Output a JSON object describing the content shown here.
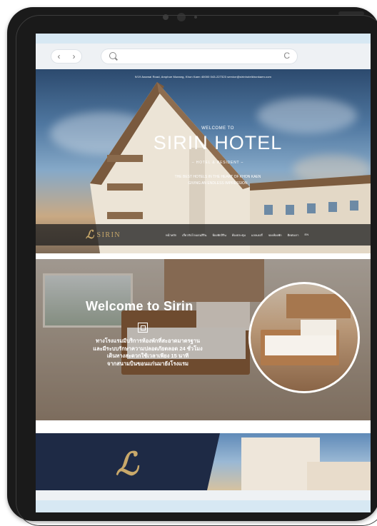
{
  "browser": {
    "back_icon": "chevron-left-icon",
    "forward_icon": "chevron-right-icon",
    "back_glyph": "‹",
    "forward_glyph": "›",
    "reload_glyph": "C",
    "url_value": ""
  },
  "hero": {
    "info_line": "9/19 Anamai Road, Amphoe Mueang, Khon Kaen 40000    043-227323    service@sirinhotelkhonkaen.com",
    "welcome_small": "WELCOME TO",
    "hotel_name": "SIRIN HOTEL",
    "hotel_sub": "– HOTEL & RESIDENT –",
    "tagline_1": "THE BEST HOTELS IN THE HEART OF KHON KAEN",
    "tagline_2": "GIVING AN ENDLESS IMPRESSION"
  },
  "navbar": {
    "logo_text": "SIRIN",
    "logo_mark": "ℒ",
    "items": [
      "หน้าหลัก",
      "เกี่ยวกับโรงแรมสิริน",
      "ห้องพักสิริน",
      "ห้องประชุม",
      "แกลเลอรี่",
      "จองห้องพัก",
      "ติดต่อเรา",
      "EN"
    ]
  },
  "welcome_section": {
    "title": "Welcome to Sirin",
    "text_1": "ทางโรงแรมมีบริการห้องพักที่สะอาดมาตรฐาน",
    "text_2": "และมีระบบรักษาความปลอดภัยตลอด 24 ชั่วโมง",
    "text_3": "เดินทางสะดวกใช้เวลาเพียง 15 นาที",
    "text_4": "จากสนามบินขอนแก่นมายังโรงแรม"
  },
  "banner": {
    "logo_mark": "ℒ"
  },
  "colors": {
    "gold": "#c8a86a",
    "navy": "#1e2a45",
    "bezel": "#1a1a1a"
  }
}
